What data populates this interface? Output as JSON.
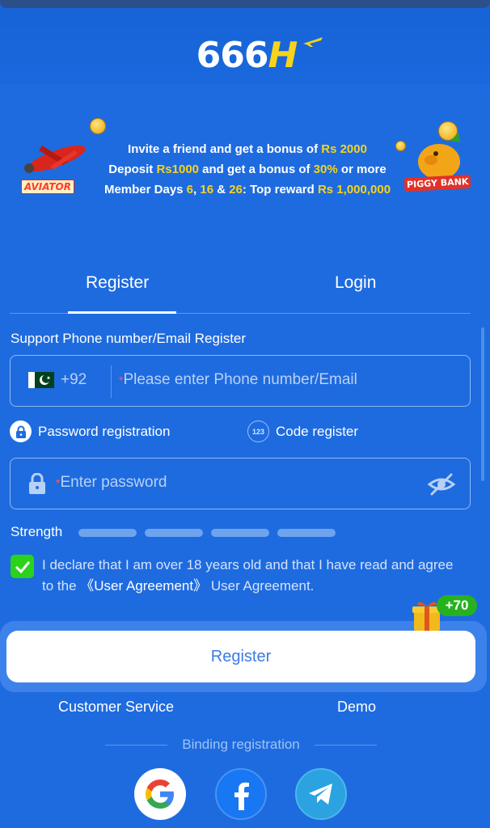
{
  "header": {
    "logo_text_num": "666",
    "logo_text_h": "H"
  },
  "banner": {
    "line1_a": "Invite a friend and get a bonus of ",
    "line1_b": "Rs 2000",
    "line2_a": "Deposit ",
    "line2_b": "Rs1000",
    "line2_c": " and get a bonus of ",
    "line2_d": "30%",
    "line2_e": " or more",
    "line3_a": "Member Days ",
    "line3_b": "6",
    "line3_c": ", ",
    "line3_d": "16",
    "line3_e": " & ",
    "line3_f": "26",
    "line3_g": ": Top reward ",
    "line3_h": "Rs 1,000,000",
    "aviator_label": "AVIATOR",
    "piggy_label": "PIGGY BANK"
  },
  "tabs": {
    "register": "Register",
    "login": "Login"
  },
  "form": {
    "support_label": "Support Phone number/Email Register",
    "country_code": "+92",
    "phone_required": "*",
    "phone_placeholder": "Please enter Phone number/Email",
    "password_mode": "Password registration",
    "code_mode": "Code register",
    "code_icon_text": "123",
    "password_required": "*",
    "password_placeholder": "Enter password",
    "strength_label": "Strength",
    "declare_a": "I declare that I am over 18 years old and that I have read and agree to the ",
    "declare_link": "《User Agreement》",
    "declare_b": " User Agreement.",
    "agreed": true,
    "register_button": "Register",
    "bonus_badge": "+70"
  },
  "footer": {
    "customer_service": "Customer Service",
    "demo": "Demo",
    "binding": "Binding registration"
  },
  "colors": {
    "background": "#1e6be0",
    "accent_yellow": "#f7d31a",
    "checkbox_green": "#2bd21a",
    "required_red": "#ff5a5a"
  },
  "icons": {
    "flag": "pakistan-flag-icon",
    "lock": "lock-icon",
    "eye_hidden": "eye-slash-icon",
    "gift": "gift-icon",
    "google": "google-icon",
    "facebook": "facebook-icon",
    "telegram": "telegram-icon"
  }
}
